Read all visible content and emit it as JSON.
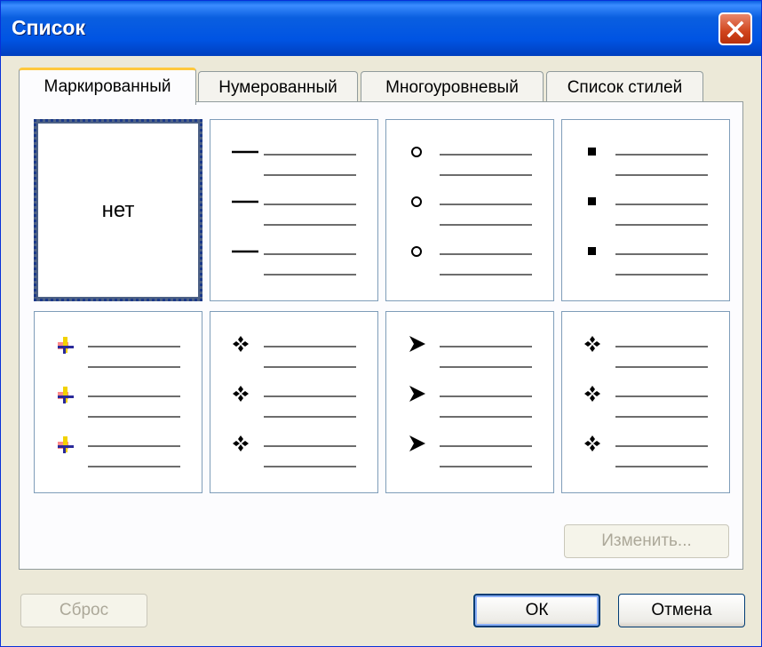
{
  "window": {
    "title": "Список"
  },
  "tabs": [
    "Маркированный",
    "Нумерованный",
    "Многоуровневый",
    "Список стилей"
  ],
  "gallery": {
    "none_label": "нет",
    "items": [
      "none",
      "dash",
      "hollow-circle",
      "square",
      "picture-bullet",
      "four-diamond",
      "arrowhead",
      "four-diamond"
    ]
  },
  "buttons": {
    "modify": "Изменить...",
    "reset": "Сброс",
    "ok": "ОК",
    "cancel": "Отмена"
  },
  "colors": {
    "title_bar": "#0054e3",
    "active_tab_accent": "#ffc83c",
    "selection_border": "#4d6185"
  }
}
